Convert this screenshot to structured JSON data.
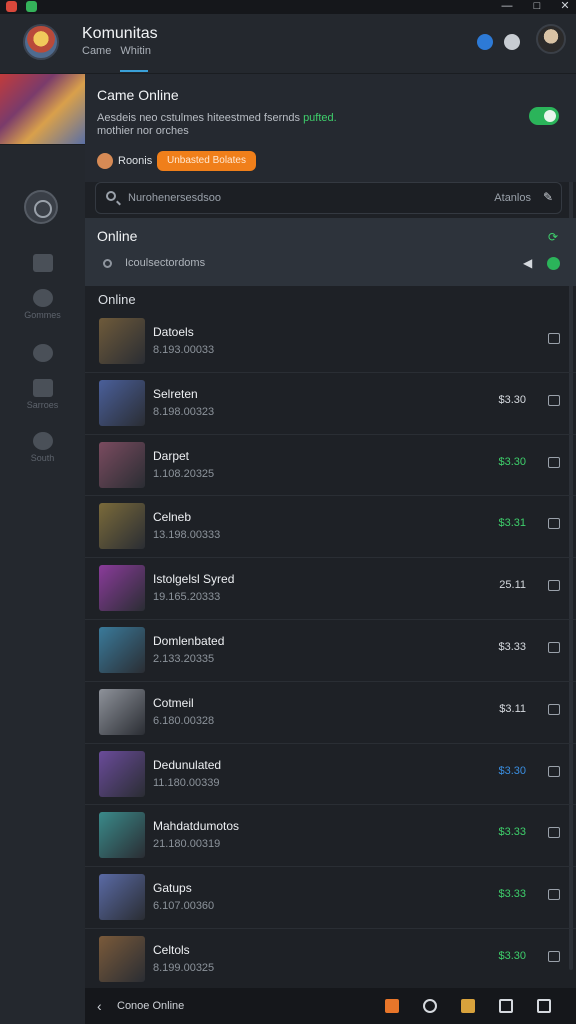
{
  "header": {
    "title": "Komunitas",
    "subtitle_left": "Came",
    "subtitle_right": "Whitin"
  },
  "sidebar": {
    "items": [
      {
        "label": "",
        "icon": "home-icon"
      },
      {
        "label": "Gommes",
        "icon": "controller-icon"
      },
      {
        "label": "",
        "icon": "helmet-icon"
      },
      {
        "label": "Sarroes",
        "icon": "list-icon"
      },
      {
        "label": "South",
        "icon": "heart-icon"
      }
    ]
  },
  "promo": {
    "title": "Came Online",
    "text_a": "Aesdeis neo cstulmes hiteestmed fsernds",
    "text_grn": "pufted.",
    "text_b": "mothier nor orches",
    "user": "Roonis",
    "pill": "Unbasted Bolates"
  },
  "search": {
    "placeholder": "Nurohenersesdsoo",
    "right_label": "Atanlos"
  },
  "online": {
    "title": "Online",
    "subtitle": "Icoulsectordoms"
  },
  "list": {
    "heading": "Online",
    "rows": [
      {
        "name": "Datoels",
        "sub": "8.193.00033",
        "value": "",
        "value_color": "#d5d9de",
        "thumb": "#6e5a3a"
      },
      {
        "name": "Selreten",
        "sub": "8.198.00323",
        "value": "$3.30",
        "value_color": "#d5d9de",
        "thumb": "#4a5f9a"
      },
      {
        "name": "Darpet",
        "sub": "1.108.20325",
        "value": "$3.30",
        "value_color": "#3ecf6b",
        "thumb": "#7a4b5f"
      },
      {
        "name": "Celneb",
        "sub": "13.198.00333",
        "value": "$3.31",
        "value_color": "#3ecf6b",
        "thumb": "#7a6a3a"
      },
      {
        "name": "Istolgelsl Syred",
        "sub": "19.165.20333",
        "value": "25.11",
        "value_color": "#d5d9de",
        "thumb": "#8a3b9a"
      },
      {
        "name": "Domlenbated",
        "sub": "2.133.20335",
        "value": "$3.33",
        "value_color": "#d5d9de",
        "thumb": "#3a7a9a"
      },
      {
        "name": "Cotmeil",
        "sub": "6.180.00328",
        "value": "$3.11",
        "value_color": "#d5d9de",
        "thumb": "#8e929a"
      },
      {
        "name": "Dedunulated",
        "sub": "11.180.00339",
        "value": "$3.30",
        "value_color": "#3a8ee0",
        "thumb": "#6a4b9a"
      },
      {
        "name": "Mahdatdumotos",
        "sub": "21.180.00319",
        "value": "$3.33",
        "value_color": "#3ecf6b",
        "thumb": "#3a8a8a"
      },
      {
        "name": "Gatups",
        "sub": "6.107.00360",
        "value": "$3.33",
        "value_color": "#3ecf6b",
        "thumb": "#5a6aa5"
      },
      {
        "name": "Celtols",
        "sub": "8.199.00325",
        "value": "$3.30",
        "value_color": "#3ecf6b",
        "thumb": "#7a5a3a"
      }
    ]
  },
  "bottom": {
    "label": "Conoe Online"
  },
  "colors": {
    "accent": "#2bb45a",
    "pill": "#f07f1a",
    "background": "#1e2126"
  }
}
